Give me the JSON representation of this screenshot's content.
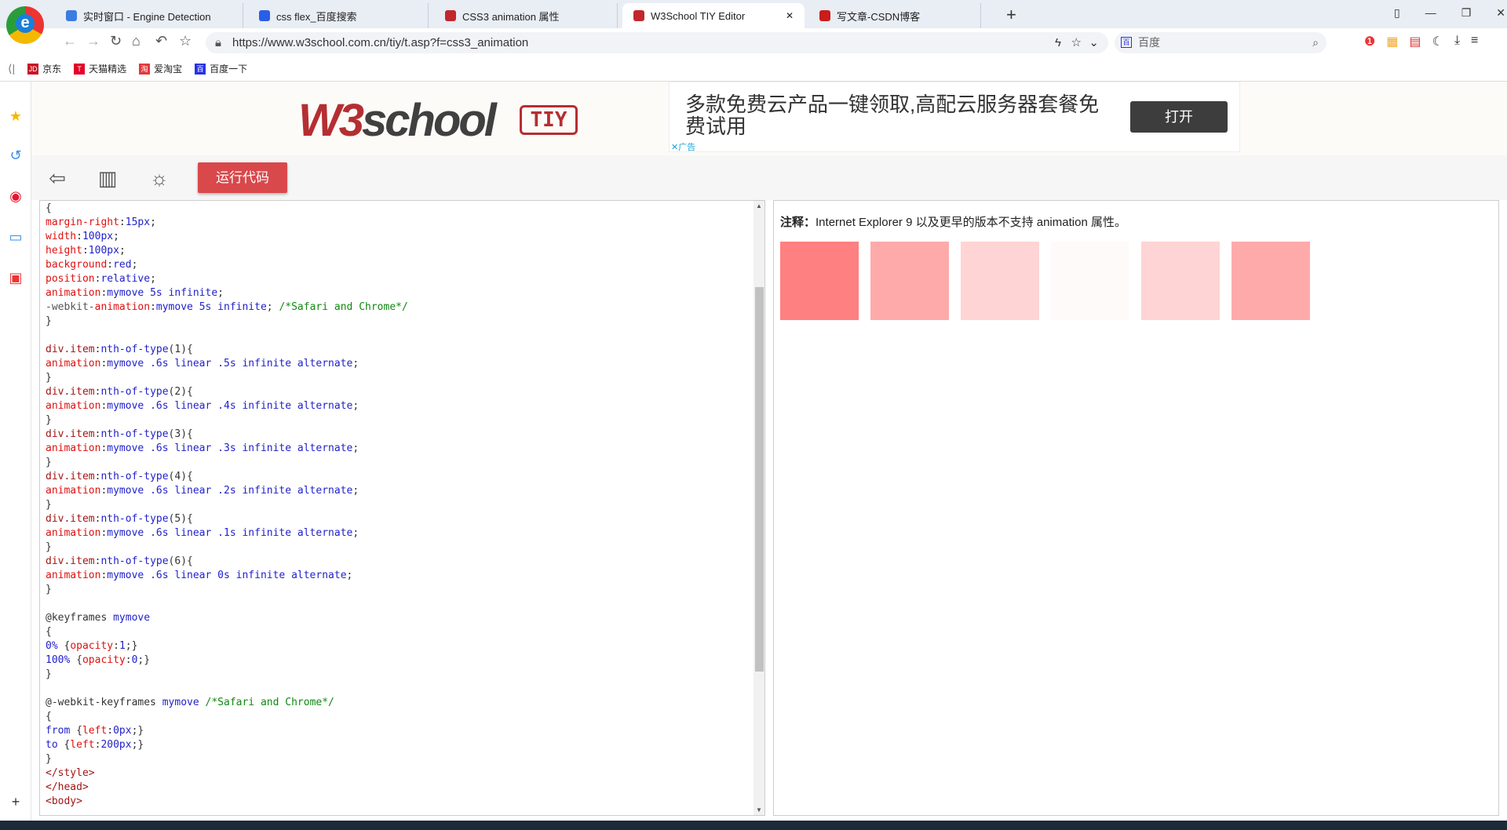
{
  "browser": {
    "tabs": [
      {
        "title": "实时窗口 - Engine Detection",
        "icon": "engine-icon",
        "color": "#3a7de0"
      },
      {
        "title": "css flex_百度搜索",
        "icon": "baidu-paw-icon",
        "color": "#2a5ee8"
      },
      {
        "title": "CSS3 animation 属性",
        "icon": "w3school-icon",
        "color": "#c1272d"
      },
      {
        "title": "W3School TIY Editor",
        "icon": "w3school-icon",
        "color": "#c1272d",
        "active": true
      },
      {
        "title": "写文章-CSDN博客",
        "icon": "csdn-icon",
        "color": "#c91c1c"
      }
    ],
    "new_tab": "+",
    "url": "https://www.w3school.com.cn/tiy/t.asp?f=css3_animation",
    "search_placeholder": "百度",
    "bookmarks": [
      {
        "label": "京东",
        "badge": "JD",
        "color": "#c81623"
      },
      {
        "label": "天猫精选",
        "badge": "T",
        "color": "#e4002b"
      },
      {
        "label": "爱淘宝",
        "badge": "淘",
        "color": "#e4393c"
      },
      {
        "label": "百度一下",
        "badge": "百",
        "color": "#2932e1"
      }
    ]
  },
  "banner": {
    "logo": "W3school",
    "tiy": "TIY",
    "ad_text": "多款免费云产品一键领取,高配云服务器套餐免费试用",
    "ad_button": "打开",
    "ad_label": "✕广告"
  },
  "toolbar": {
    "run_label": "运行代码"
  },
  "editor": {
    "lines": [
      [
        [
          "k",
          "{"
        ]
      ],
      [
        [
          "p",
          "margin-right"
        ],
        [
          "k",
          ":"
        ],
        [
          "v",
          "15px"
        ],
        [
          "k",
          ";"
        ]
      ],
      [
        [
          "p",
          "width"
        ],
        [
          "k",
          ":"
        ],
        [
          "v",
          "100px"
        ],
        [
          "k",
          ";"
        ]
      ],
      [
        [
          "p",
          "height"
        ],
        [
          "k",
          ":"
        ],
        [
          "v",
          "100px"
        ],
        [
          "k",
          ";"
        ]
      ],
      [
        [
          "p",
          "background"
        ],
        [
          "k",
          ":"
        ],
        [
          "v",
          "red"
        ],
        [
          "k",
          ";"
        ]
      ],
      [
        [
          "p",
          "position"
        ],
        [
          "k",
          ":"
        ],
        [
          "v",
          "relative"
        ],
        [
          "k",
          ";"
        ]
      ],
      [
        [
          "p",
          "animation"
        ],
        [
          "k",
          ":"
        ],
        [
          "v",
          "mymove 5s infinite"
        ],
        [
          "k",
          ";"
        ]
      ],
      [
        [
          "g",
          "-webkit-"
        ],
        [
          "p",
          "animation"
        ],
        [
          "k",
          ":"
        ],
        [
          "v",
          "mymove 5s infinite"
        ],
        [
          "k",
          "; "
        ],
        [
          "c",
          "/*Safari and Chrome*/"
        ]
      ],
      [
        [
          "k",
          "}"
        ]
      ],
      [],
      [
        [
          "s",
          "div.item"
        ],
        [
          "k",
          ":"
        ],
        [
          "v",
          "nth-of-type"
        ],
        [
          "k",
          "(1){"
        ]
      ],
      [
        [
          "p",
          "animation"
        ],
        [
          "k",
          ":"
        ],
        [
          "v",
          "mymove .6s linear .5s infinite alternate"
        ],
        [
          "k",
          ";"
        ]
      ],
      [
        [
          "k",
          "}"
        ]
      ],
      [
        [
          "s",
          "div.item"
        ],
        [
          "k",
          ":"
        ],
        [
          "v",
          "nth-of-type"
        ],
        [
          "k",
          "(2){"
        ]
      ],
      [
        [
          "p",
          "animation"
        ],
        [
          "k",
          ":"
        ],
        [
          "v",
          "mymove .6s linear .4s infinite alternate"
        ],
        [
          "k",
          ";"
        ]
      ],
      [
        [
          "k",
          "}"
        ]
      ],
      [
        [
          "s",
          "div.item"
        ],
        [
          "k",
          ":"
        ],
        [
          "v",
          "nth-of-type"
        ],
        [
          "k",
          "(3){"
        ]
      ],
      [
        [
          "p",
          "animation"
        ],
        [
          "k",
          ":"
        ],
        [
          "v",
          "mymove .6s linear .3s infinite alternate"
        ],
        [
          "k",
          ";"
        ]
      ],
      [
        [
          "k",
          "}"
        ]
      ],
      [
        [
          "s",
          "div.item"
        ],
        [
          "k",
          ":"
        ],
        [
          "v",
          "nth-of-type"
        ],
        [
          "k",
          "(4){"
        ]
      ],
      [
        [
          "p",
          "animation"
        ],
        [
          "k",
          ":"
        ],
        [
          "v",
          "mymove .6s linear .2s infinite alternate"
        ],
        [
          "k",
          ";"
        ]
      ],
      [
        [
          "k",
          "}"
        ]
      ],
      [
        [
          "s",
          "div.item"
        ],
        [
          "k",
          ":"
        ],
        [
          "v",
          "nth-of-type"
        ],
        [
          "k",
          "(5){"
        ]
      ],
      [
        [
          "p",
          "animation"
        ],
        [
          "k",
          ":"
        ],
        [
          "v",
          "mymove .6s linear .1s infinite alternate"
        ],
        [
          "k",
          ";"
        ]
      ],
      [
        [
          "k",
          "}"
        ]
      ],
      [
        [
          "s",
          "div.item"
        ],
        [
          "k",
          ":"
        ],
        [
          "v",
          "nth-of-type"
        ],
        [
          "k",
          "(6){"
        ]
      ],
      [
        [
          "p",
          "animation"
        ],
        [
          "k",
          ":"
        ],
        [
          "v",
          "mymove .6s linear 0s infinite alternate"
        ],
        [
          "k",
          ";"
        ]
      ],
      [
        [
          "k",
          "}"
        ]
      ],
      [],
      [
        [
          "k",
          "@keyframes "
        ],
        [
          "v",
          "mymove"
        ]
      ],
      [
        [
          "k",
          "{"
        ]
      ],
      [
        [
          "v",
          "0% "
        ],
        [
          "k",
          "{"
        ],
        [
          "p",
          "opacity"
        ],
        [
          "k",
          ":"
        ],
        [
          "v",
          "1"
        ],
        [
          "k",
          ";}"
        ]
      ],
      [
        [
          "v",
          "100% "
        ],
        [
          "k",
          "{"
        ],
        [
          "p",
          "opacity"
        ],
        [
          "k",
          ":"
        ],
        [
          "v",
          "0"
        ],
        [
          "k",
          ";}"
        ]
      ],
      [
        [
          "k",
          "}"
        ]
      ],
      [],
      [
        [
          "k",
          "@-webkit-keyframes "
        ],
        [
          "v",
          "mymove "
        ],
        [
          "c",
          "/*Safari and Chrome*/"
        ]
      ],
      [
        [
          "k",
          "{"
        ]
      ],
      [
        [
          "v",
          "from "
        ],
        [
          "k",
          "{"
        ],
        [
          "p",
          "left"
        ],
        [
          "k",
          ":"
        ],
        [
          "v",
          "0px"
        ],
        [
          "k",
          ";}"
        ]
      ],
      [
        [
          "v",
          "to "
        ],
        [
          "k",
          "{"
        ],
        [
          "p",
          "left"
        ],
        [
          "k",
          ":"
        ],
        [
          "v",
          "200px"
        ],
        [
          "k",
          ";}"
        ]
      ],
      [
        [
          "k",
          "}"
        ]
      ],
      [
        [
          "s",
          "</style>"
        ]
      ],
      [
        [
          "s",
          "</head>"
        ]
      ],
      [
        [
          "s",
          "<body>"
        ]
      ]
    ]
  },
  "result": {
    "note_label": "注释：",
    "note_text": "Internet Explorer 9 以及更早的版本不支持 animation 属性。",
    "boxes": [
      {
        "color": "#ff8080"
      },
      {
        "color": "#ffaaaa"
      },
      {
        "color": "#ffd4d4"
      },
      {
        "color": "#fffafa"
      },
      {
        "color": "#ffd4d4"
      },
      {
        "color": "#ffaaaa"
      }
    ]
  }
}
